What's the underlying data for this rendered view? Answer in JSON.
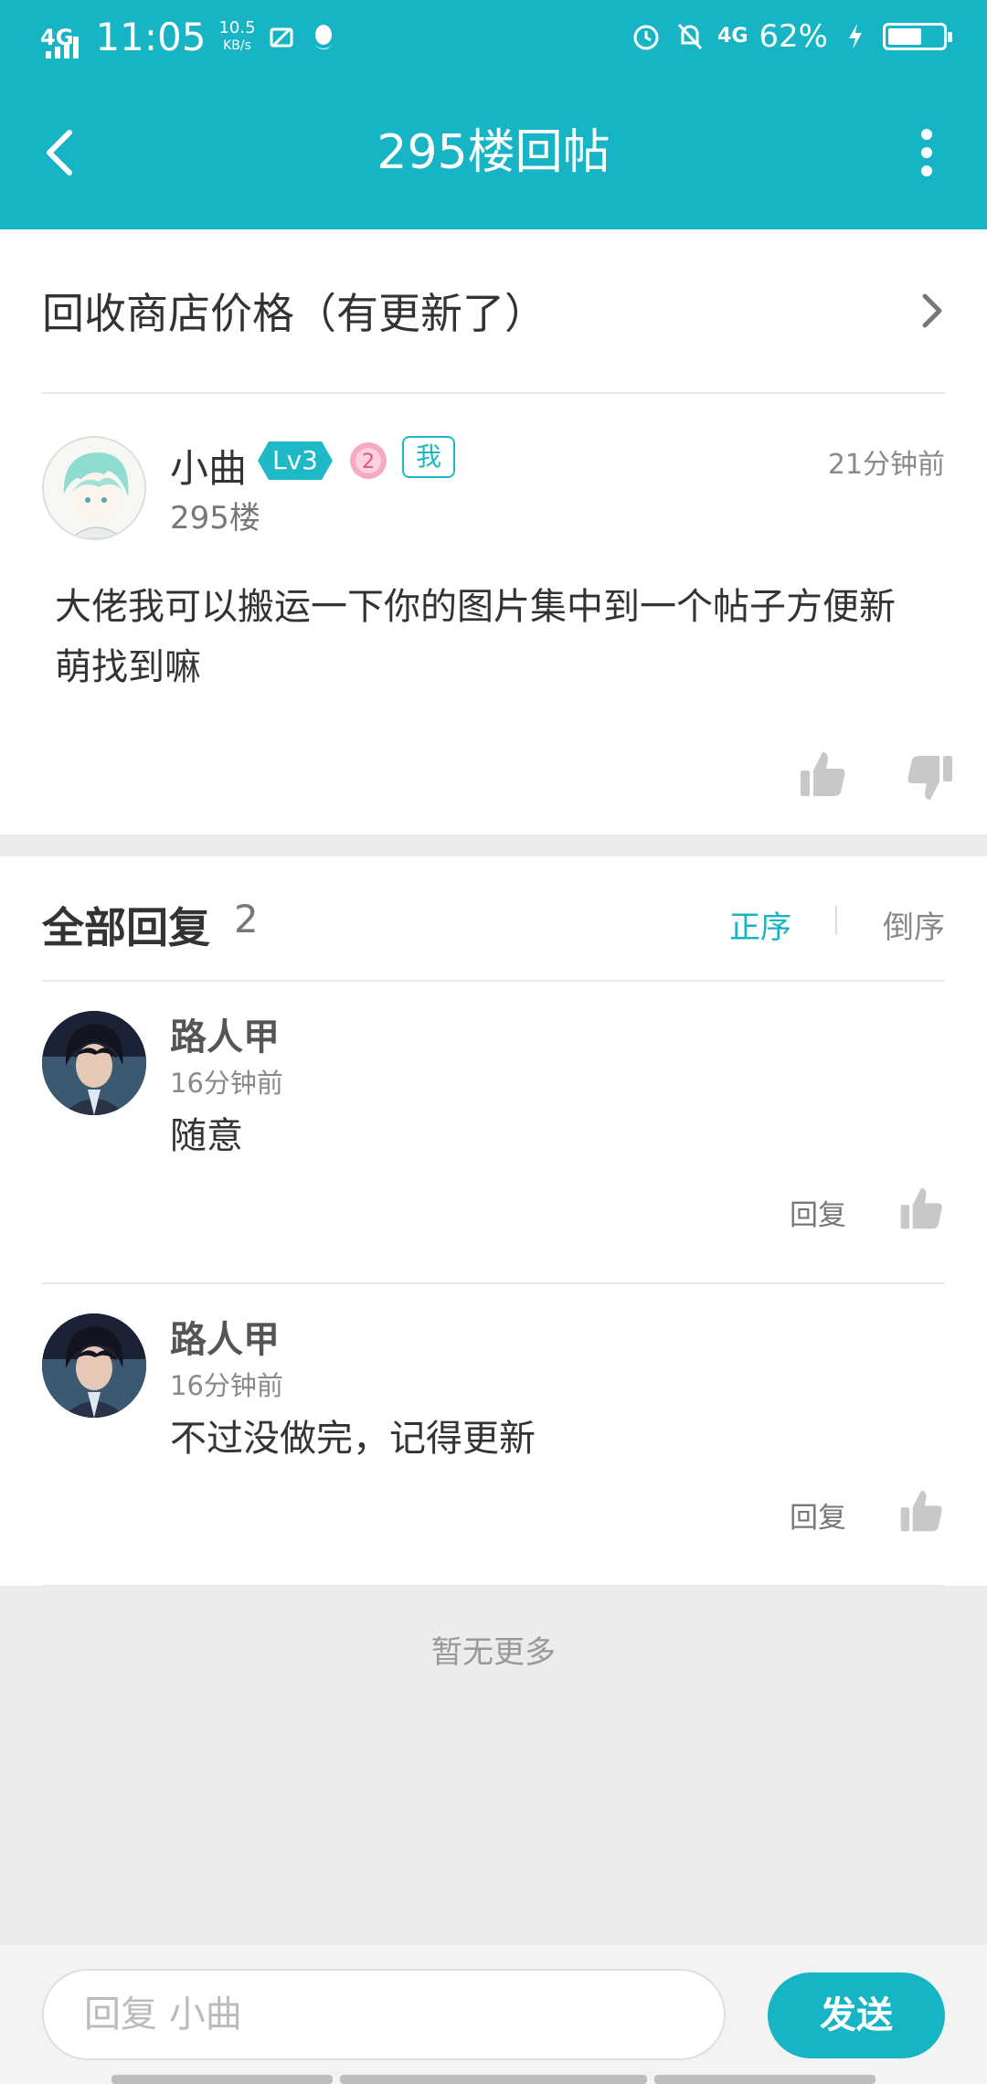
{
  "status_bar": {
    "network": "4G",
    "time": "11:05",
    "speed_value": "10.5",
    "speed_unit": "KB/s",
    "network_right": "4G",
    "battery_pct_text": "62%",
    "battery_level": 0.62
  },
  "nav": {
    "title": "295楼回帖"
  },
  "thread": {
    "title": "回收商店价格（有更新了）"
  },
  "post": {
    "author": "小曲",
    "level": "Lv3",
    "pink_badge": "2",
    "me_badge": "我",
    "time": "21分钟前",
    "floor": "295楼",
    "body": "大佬我可以搬运一下你的图片集中到一个帖子方便新萌找到嘛"
  },
  "replies": {
    "title": "全部回复",
    "count": "2",
    "sort_asc": "正序",
    "sort_desc": "倒序",
    "items": [
      {
        "name": "路人甲",
        "time": "16分钟前",
        "text": "随意",
        "reply_label": "回复"
      },
      {
        "name": "路人甲",
        "time": "16分钟前",
        "text": "不过没做完，记得更新",
        "reply_label": "回复"
      }
    ],
    "no_more": "暂无更多"
  },
  "composer": {
    "placeholder": "回复 小曲",
    "send_label": "发送"
  },
  "colors": {
    "accent": "#16b4c4",
    "page_bg": "#ececec",
    "text": "#333333",
    "muted": "#8a8a8a"
  }
}
